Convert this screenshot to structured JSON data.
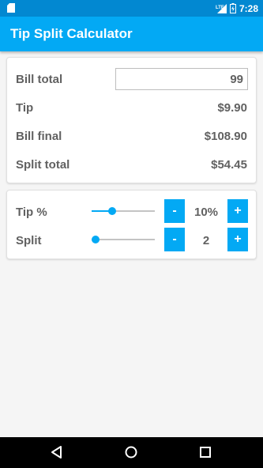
{
  "status_bar": {
    "time": "7:28",
    "network": "LTE",
    "icons": [
      "sd-card-icon",
      "signal-icon",
      "battery-icon"
    ]
  },
  "app_bar": {
    "title": "Tip Split Calculator"
  },
  "summary": {
    "bill_total_label": "Bill total",
    "bill_total_value": "99",
    "tip_label": "Tip",
    "tip_value": "$9.90",
    "bill_final_label": "Bill final",
    "bill_final_value": "$108.90",
    "split_total_label": "Split total",
    "split_total_value": "$54.45"
  },
  "controls": {
    "tip": {
      "label": "Tip %",
      "value": "10%",
      "slider_fraction": 0.33,
      "minus_label": "-",
      "plus_label": "+"
    },
    "split": {
      "label": "Split",
      "value": "2",
      "slider_fraction": 0.06,
      "minus_label": "-",
      "plus_label": "+"
    }
  },
  "colors": {
    "accent": "#03a9f4",
    "status_bar": "#0288d1",
    "text": "#616161",
    "background": "#f5f5f5"
  },
  "nav_bar": {
    "icons": [
      "back-icon",
      "home-icon",
      "recents-icon"
    ]
  }
}
